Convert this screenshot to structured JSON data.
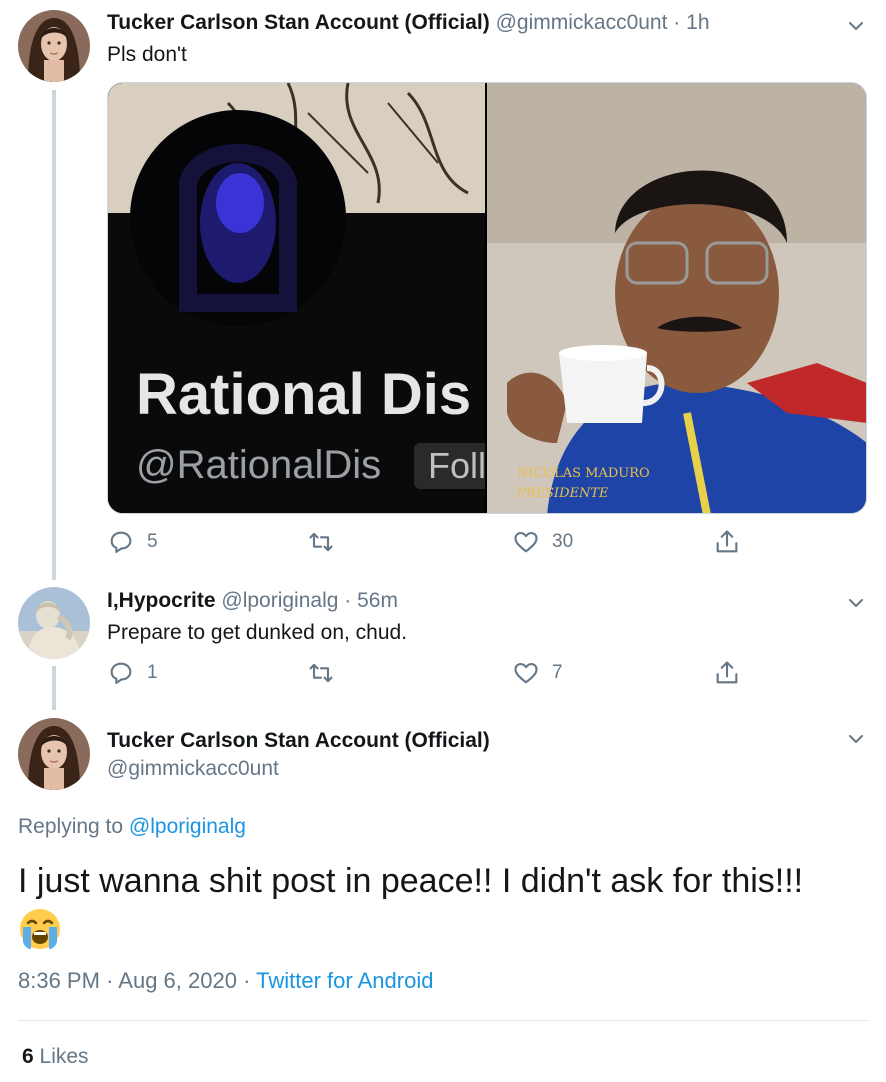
{
  "tweet1": {
    "display_name": "Tucker Carlson Stan Account (Official)",
    "handle": "@gimmickacc0unt",
    "separator": "·",
    "time": "1h",
    "text": "Pls don't",
    "media": {
      "left_name_text": "Rational Dis",
      "left_handle_text": "@RationalDis",
      "left_follow_text": "Foll",
      "right_caption_line1": "NICOLAS MADURO",
      "right_caption_line2": "PRESIDENTE"
    },
    "actions": {
      "reply_count": "5",
      "retweet_count": "",
      "like_count": "30"
    }
  },
  "tweet2": {
    "display_name": "I,Hypocrite",
    "handle": "@lporiginalg",
    "separator": "·",
    "time": "56m",
    "text": "Prepare to get dunked on, chud.",
    "actions": {
      "reply_count": "1",
      "retweet_count": "",
      "like_count": "7"
    }
  },
  "main_tweet": {
    "display_name": "Tucker Carlson Stan Account (Official)",
    "handle": "@gimmickacc0unt",
    "replying_to_label": "Replying to",
    "replying_to_handle": "@lporiginalg",
    "text": "I just wanna shit post in peace!! I didn't ask for this!!!",
    "emoji": "loudly-crying-face",
    "time": "8:36 PM",
    "separator1": "·",
    "date": "Aug 6, 2020",
    "separator2": "·",
    "source": "Twitter for Android",
    "likes_count": "6",
    "likes_label": "Likes"
  },
  "colors": {
    "text_primary": "#14171a",
    "text_secondary": "#657786",
    "link": "#1b95e0",
    "thread_line": "#ccd6dd",
    "divider": "#e1e8ed"
  }
}
